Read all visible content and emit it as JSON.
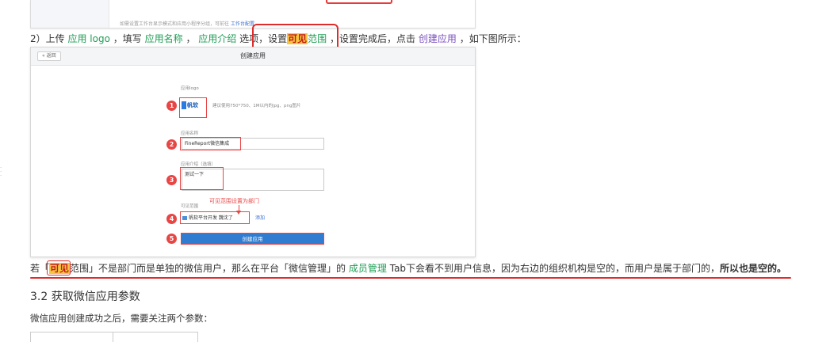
{
  "top_screenshot": {
    "hint_text": "如需设置工作台显示模式和应用小程序分组，可前往",
    "hint_link": "工作台配置"
  },
  "step2": {
    "prefix": "2）上传",
    "logo": "应用 logo",
    "fill": "，填写",
    "name": "应用名称",
    "comma": "，",
    "intro": "应用介绍",
    "option": "选项，设置",
    "vis_highlight": "可见",
    "vis_rest": "范围",
    "done": "，设置完成后，点击",
    "create": "创建应用",
    "suffix": "，如下图所示："
  },
  "screenshot": {
    "back_button": "« 返回",
    "title": "创建应用",
    "logo_label": "应用logo",
    "logo_text": "帆软",
    "logo_hint": "建议使用750*750、1M以内的jpg、png图片",
    "name_label": "应用名称",
    "name_value": "FineReport微信集成",
    "intro_label": "应用介绍（选填）",
    "intro_value": "测试一下",
    "visible_label": "可见范围",
    "visible_note": "可见范围设置为部门",
    "dept_value": "帆软平台开发 魏沈了",
    "add_link": "添加",
    "create_button": "创建应用",
    "badges": [
      "1",
      "2",
      "3",
      "4",
      "5"
    ]
  },
  "paragraph": {
    "p1": "若「",
    "p2": "可见",
    "p3": "范围」不是部门而是单独的微信用户，那么在平台「微信管理」的",
    "p4": "成员管理",
    "p5": "Tab下会看不到用户信息，因为右边的组织机构是空的，而用户是属于部门的，",
    "p6": "所以也是空的。"
  },
  "section": {
    "heading": "3.2 获取微信应用参数",
    "desc": "微信应用创建成功之后，需要关注两个参数："
  },
  "colors": {
    "accent_red": "#e02b2b",
    "link_green": "#1f9d55",
    "link_purple": "#7a4fbf",
    "highlight_yellow": "#f7c640",
    "button_blue": "#2f7cd1"
  }
}
